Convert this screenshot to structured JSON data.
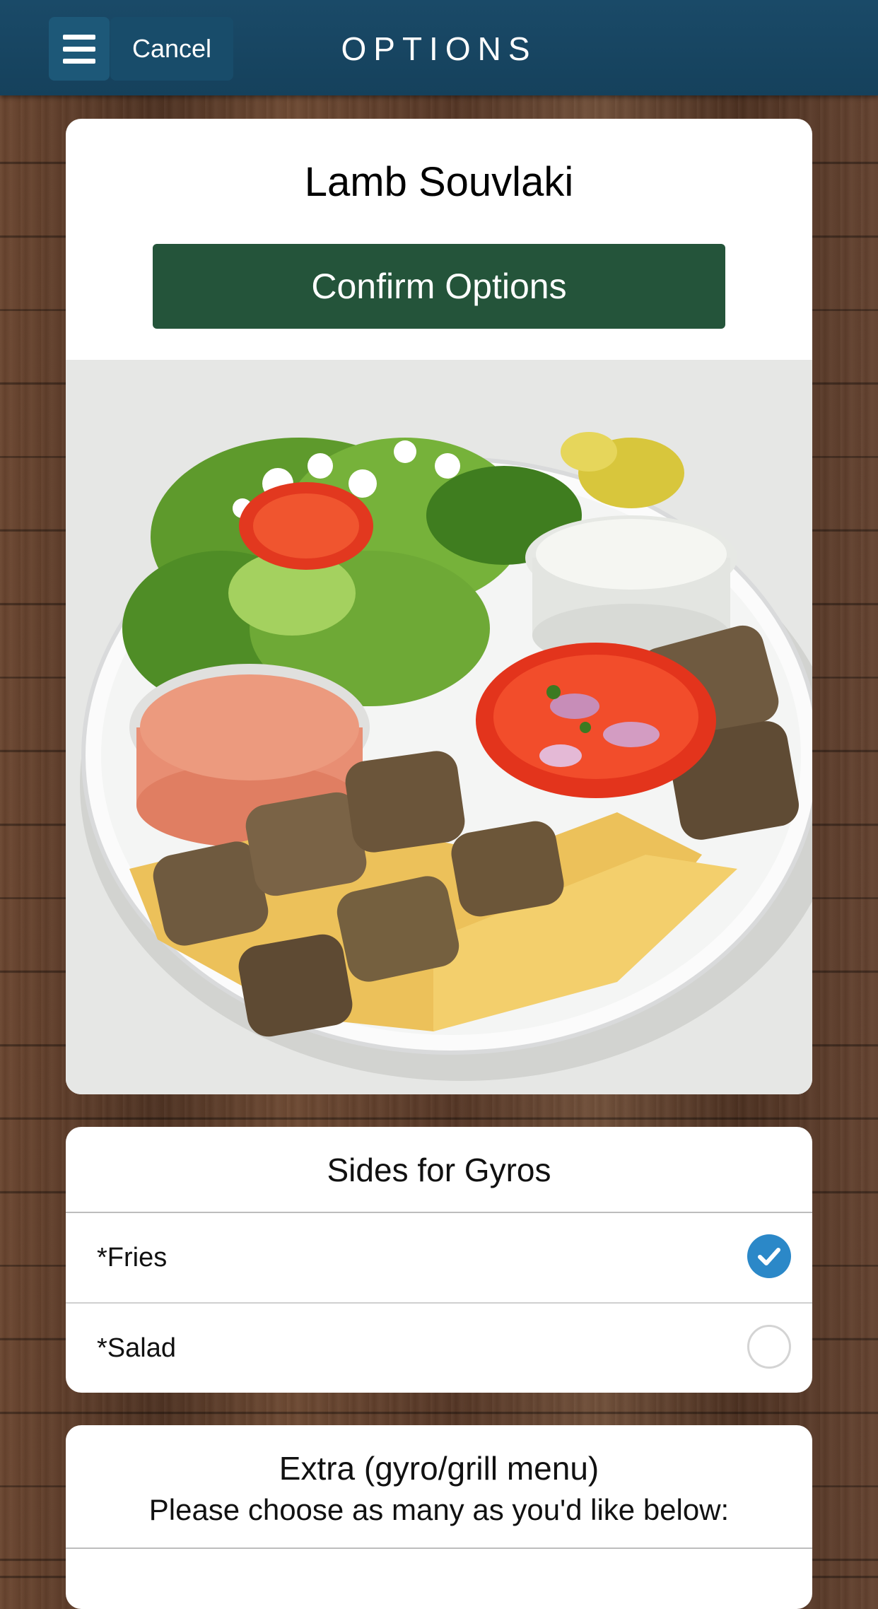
{
  "header": {
    "cancel_label": "Cancel",
    "title": "OPTIONS",
    "menu_icon": "hamburger-menu-icon"
  },
  "item": {
    "name": "Lamb Souvlaki",
    "confirm_label": "Confirm Options"
  },
  "sides": {
    "title": "Sides for Gyros",
    "options": [
      {
        "label": "*Fries",
        "selected": true
      },
      {
        "label": "*Salad",
        "selected": false
      }
    ]
  },
  "extra": {
    "title": "Extra (gyro/grill menu)",
    "subtitle": "Please choose as many as you'd like below:"
  },
  "colors": {
    "header": "#15415c",
    "confirm": "#24543a",
    "selected": "#2b88c8"
  }
}
